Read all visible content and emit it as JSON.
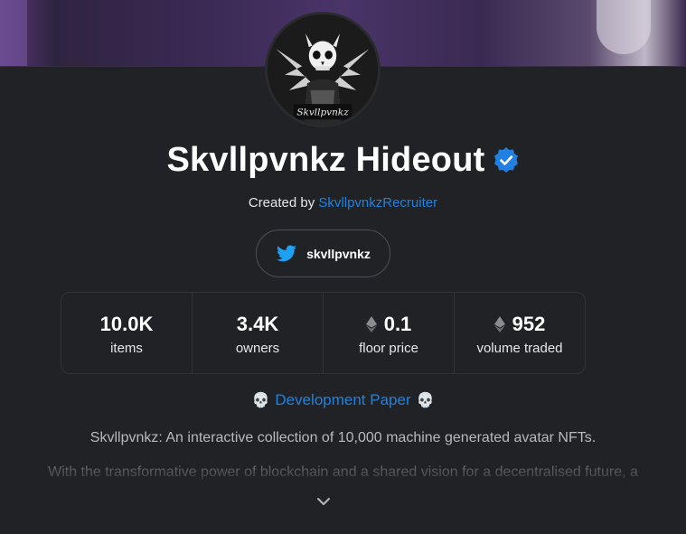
{
  "collection": {
    "name": "Skvllpvnkz Hideout",
    "verified": true,
    "created_by_prefix": "Created by",
    "creator": "SkvllpvnkzRecruiter"
  },
  "social": {
    "twitter_handle": "skvllpvnkz",
    "icon": "twitter-icon"
  },
  "stats": [
    {
      "value": "10.0K",
      "label": "items",
      "eth": false
    },
    {
      "value": "3.4K",
      "label": "owners",
      "eth": false
    },
    {
      "value": "0.1",
      "label": "floor price",
      "eth": true
    },
    {
      "value": "952",
      "label": "volume traded",
      "eth": true
    }
  ],
  "dev_paper": {
    "label": "Development Paper",
    "emoji": "💀"
  },
  "description": {
    "line1": "Skvllpvnkz: An interactive collection of 10,000 machine generated avatar NFTs.",
    "line2": "With the transformative power of blockchain and a shared vision for a decentralised future, a"
  },
  "colors": {
    "background": "#202225",
    "link": "#2081e2",
    "verified": "#2081e2",
    "twitter": "#1da1f2"
  }
}
